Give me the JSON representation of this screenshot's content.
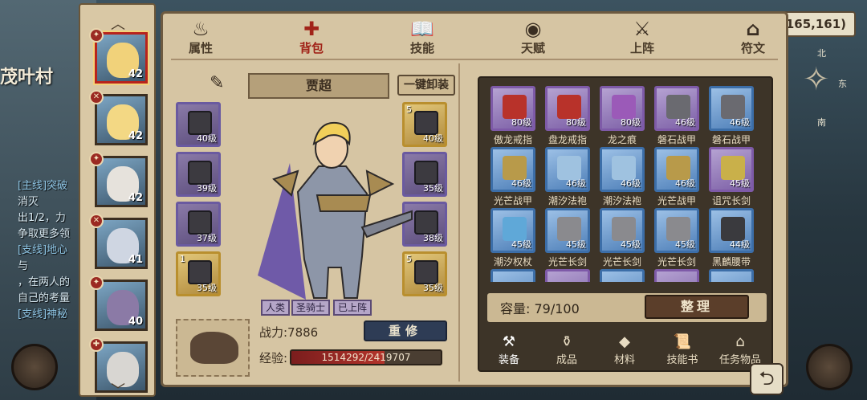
{
  "world": {
    "village": "茂叶村",
    "coordinates": "(165,161)",
    "quests": [
      {
        "text": "[主线]突破",
        "tag": true
      },
      {
        "text": "消灭",
        "tag": false
      },
      {
        "text": "出1/2，力",
        "tag": false
      },
      {
        "text": "争取更多领",
        "tag": false
      },
      {
        "text": "[支线]地心",
        "tag": true
      },
      {
        "text": "与",
        "tag": false
      },
      {
        "text": "，在两人的",
        "tag": false
      },
      {
        "text": "自己的考量",
        "tag": false
      },
      {
        "text": "[支线]神秘",
        "tag": true
      }
    ],
    "compass": {
      "n": "北",
      "e": "东",
      "s": "南"
    }
  },
  "roster": [
    {
      "level": "42",
      "badge": "✦",
      "skin": "#f1d27a",
      "selected": true
    },
    {
      "level": "42",
      "badge": "✕",
      "skin": "#f3d884",
      "selected": false
    },
    {
      "level": "42",
      "badge": "✦",
      "skin": "#e6e2dc",
      "selected": false
    },
    {
      "level": "41",
      "badge": "✕",
      "skin": "#cfd6e2",
      "selected": false
    },
    {
      "level": "40",
      "badge": "✦",
      "skin": "#8b7aa6",
      "selected": false
    },
    {
      "level": "",
      "badge": "✚",
      "skin": "#d8d6d2",
      "selected": false
    }
  ],
  "tabs": [
    {
      "label": "属性",
      "icon": "♨",
      "active": false
    },
    {
      "label": "背包",
      "icon": "✚",
      "active": true
    },
    {
      "label": "技能",
      "icon": "📖",
      "active": false
    },
    {
      "label": "天赋",
      "icon": "◉",
      "active": false
    },
    {
      "label": "上阵",
      "icon": "⚔",
      "active": false
    },
    {
      "label": "符文",
      "icon": "⌂",
      "active": false
    }
  ],
  "character": {
    "name": "贾超",
    "unequip_all": "一键卸装",
    "left_slots": [
      {
        "level": "40级",
        "count": "",
        "gold": false
      },
      {
        "level": "39级",
        "count": "",
        "gold": false
      },
      {
        "level": "37级",
        "count": "",
        "gold": false
      },
      {
        "level": "35级",
        "count": "1",
        "gold": true
      }
    ],
    "right_slots": [
      {
        "level": "40级",
        "count": "5",
        "gold": true
      },
      {
        "level": "35级",
        "count": "",
        "gold": false
      },
      {
        "level": "38级",
        "count": "",
        "gold": false
      },
      {
        "level": "35级",
        "count": "5",
        "gold": true
      }
    ],
    "tags": [
      "人类",
      "圣骑士",
      "已上阵"
    ],
    "power_label": "战力:7886",
    "repair_label": "重修",
    "exp_label": "经验:",
    "exp_text": "1514292/2419707",
    "exp_progress": 0.6258
  },
  "inventory": {
    "items": [
      {
        "name": "傲龙戒指",
        "level": "80级",
        "rarity": "purple",
        "color": "#b8322a"
      },
      {
        "name": "盘龙戒指",
        "level": "80级",
        "rarity": "purple",
        "color": "#b8322a"
      },
      {
        "name": "龙之痕",
        "level": "80级",
        "rarity": "purple",
        "color": "#9b5ab8"
      },
      {
        "name": "磐石战甲",
        "level": "46级",
        "rarity": "purple",
        "color": "#6a6a70"
      },
      {
        "name": "磐石战甲",
        "level": "46级",
        "rarity": "blue",
        "color": "#6a6a70"
      },
      {
        "name": "光芒战甲",
        "level": "46级",
        "rarity": "blue",
        "color": "#b89a4a"
      },
      {
        "name": "潮汐法袍",
        "level": "46级",
        "rarity": "blue",
        "color": "#9fc2e0"
      },
      {
        "name": "潮汐法袍",
        "level": "46级",
        "rarity": "blue",
        "color": "#9fc2e0"
      },
      {
        "name": "光芒战甲",
        "level": "46级",
        "rarity": "blue",
        "color": "#b89a4a"
      },
      {
        "name": "诅咒长剑",
        "level": "45级",
        "rarity": "purple",
        "color": "#c9b04a"
      },
      {
        "name": "潮汐权杖",
        "level": "45级",
        "rarity": "blue",
        "color": "#5fa8d8"
      },
      {
        "name": "光芒长剑",
        "level": "45级",
        "rarity": "blue",
        "color": "#8a8a8e"
      },
      {
        "name": "光芒长剑",
        "level": "45级",
        "rarity": "blue",
        "color": "#8a8a8e"
      },
      {
        "name": "光芒长剑",
        "level": "45级",
        "rarity": "blue",
        "color": "#8a8a8e"
      },
      {
        "name": "黑麟腰带",
        "level": "44级",
        "rarity": "blue",
        "color": "#3a3a3e"
      }
    ],
    "capacity_label": "容量:",
    "capacity_value": "79/100",
    "sort_label": "整理",
    "categories": [
      {
        "label": "装备",
        "icon": "⚒",
        "active": true
      },
      {
        "label": "成品",
        "icon": "⚱",
        "active": false
      },
      {
        "label": "材料",
        "icon": "◆",
        "active": false
      },
      {
        "label": "技能书",
        "icon": "📜",
        "active": false
      },
      {
        "label": "任务物品",
        "icon": "⌂",
        "active": false
      }
    ]
  }
}
